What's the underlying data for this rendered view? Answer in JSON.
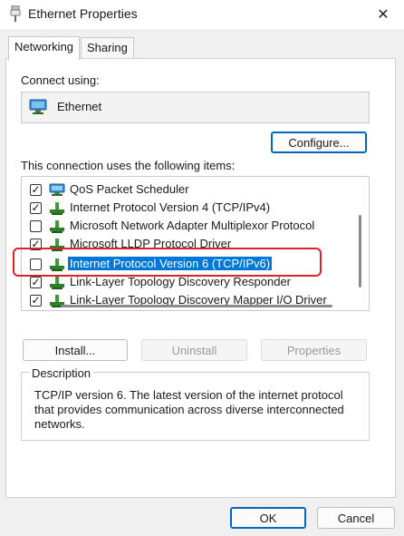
{
  "window": {
    "title": "Ethernet Properties",
    "close_glyph": "✕",
    "icon": "network-cable-icon"
  },
  "tabs": [
    {
      "label": "Networking",
      "active": true
    },
    {
      "label": "Sharing",
      "active": false
    }
  ],
  "connect_using": {
    "label": "Connect using:",
    "adapter_name": "Ethernet",
    "adapter_icon": "network-adapter-icon"
  },
  "buttons": {
    "configure": "Configure...",
    "install": "Install...",
    "uninstall": "Uninstall",
    "properties": "Properties",
    "ok": "OK",
    "cancel": "Cancel"
  },
  "items_label": "This connection uses the following items:",
  "items": [
    {
      "label": "QoS Packet Scheduler",
      "checked": true,
      "icon": "network-service-icon",
      "selected": false
    },
    {
      "label": "Internet Protocol Version 4 (TCP/IPv4)",
      "checked": true,
      "icon": "protocol-icon",
      "selected": false
    },
    {
      "label": "Microsoft Network Adapter Multiplexor Protocol",
      "checked": false,
      "icon": "protocol-icon",
      "selected": false
    },
    {
      "label": "Microsoft LLDP Protocol Driver",
      "checked": true,
      "icon": "protocol-icon",
      "selected": false
    },
    {
      "label": "Internet Protocol Version 6 (TCP/IPv6)",
      "checked": false,
      "icon": "protocol-icon",
      "selected": true
    },
    {
      "label": "Link-Layer Topology Discovery Responder",
      "checked": true,
      "icon": "protocol-icon",
      "selected": false
    },
    {
      "label": "Link-Layer Topology Discovery Mapper I/O Driver",
      "checked": true,
      "icon": "protocol-icon",
      "selected": false
    }
  ],
  "description": {
    "title": "Description",
    "text": "TCP/IP version 6. The latest version of the internet protocol that provides communication across diverse interconnected networks."
  },
  "colors": {
    "selection": "#0078d7",
    "highlight_outline": "#e0202a",
    "primary_border": "#0067c0"
  }
}
